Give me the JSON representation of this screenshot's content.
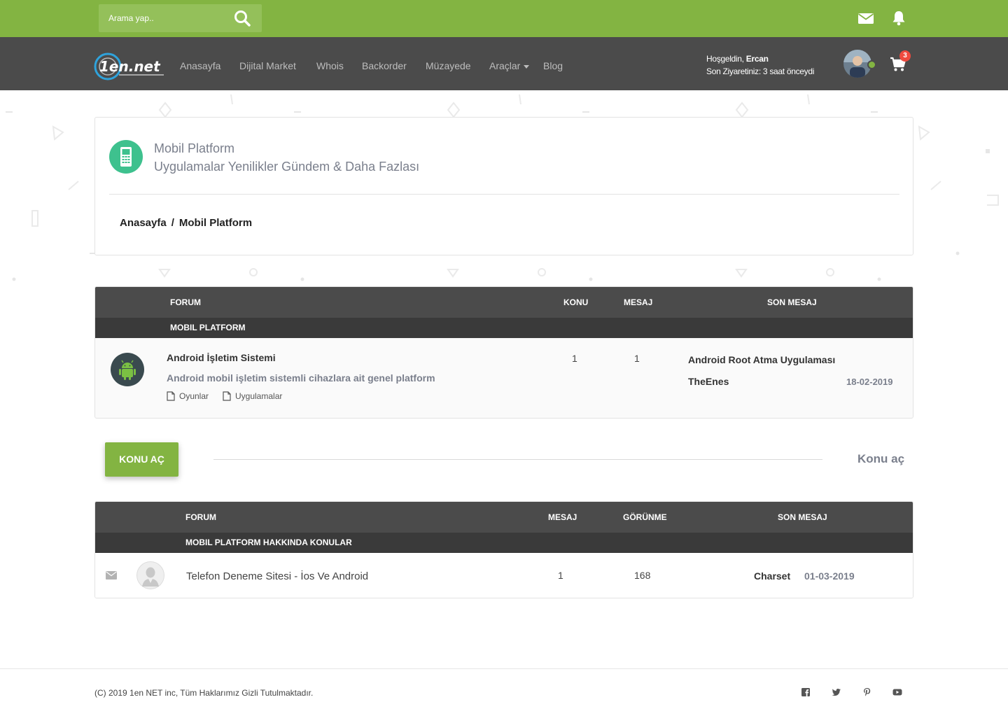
{
  "search": {
    "placeholder": "Arama yap.."
  },
  "header": {
    "mail_icon": "envelope-icon",
    "notification_icon": "bell-icon"
  },
  "nav": {
    "items": [
      "Anasayfa",
      "Dijital Market",
      "Whois",
      "Backorder",
      "Müzayede",
      "Araçlar",
      "Blog"
    ],
    "user": {
      "greeting_prefix": "Hoşgeldin, ",
      "name": "Ercan",
      "last_visit": "Son Ziyaretiniz: 3 saat önceydi"
    },
    "cart_count": "3"
  },
  "page_header": {
    "title": "Mobil Platform",
    "subtitle": "Uygulamalar Yenilikler Gündem & Daha Fazlası",
    "breadcrumb": [
      "Anasayfa",
      "Mobil Platform"
    ],
    "breadcrumb_sep": "/"
  },
  "forum_table": {
    "columns": {
      "forum": "FORUM",
      "konu": "KONU",
      "mesaj": "MESAJ",
      "son_mesaj": "SON MESAJ"
    },
    "group": "MOBIL PLATFORM",
    "rows": [
      {
        "title": "Android İşletim Sistemi",
        "description": "Android mobil işletim sistemli cihazlara ait genel platform",
        "subforums": [
          "Oyunlar",
          "Uygulamalar"
        ],
        "konu": "1",
        "mesaj": "1",
        "last_title": "Android Root Atma Uygulaması",
        "last_user": "TheEnes",
        "last_date": "18-02-2019"
      }
    ]
  },
  "actions": {
    "new_topic_button": "KONU AÇ",
    "new_topic_link": "Konu aç"
  },
  "topics_table": {
    "columns": {
      "forum": "FORUM",
      "mesaj": "MESAJ",
      "gorunme": "GÖRÜNME",
      "son_mesaj": "SON MESAJ"
    },
    "group": "MOBIL PLATFORM HAKKINDA KONULAR",
    "rows": [
      {
        "title": "Telefon Deneme Sitesi - İos Ve Android",
        "mesaj": "1",
        "gorunme": "168",
        "last_user": "Charset",
        "last_date": "01-03-2019"
      }
    ]
  },
  "footer": {
    "copyright": "(C) 2019 1en NET inc, Tüm Haklarımız Gizli Tutulmaktadır.",
    "social": [
      "facebook-icon",
      "twitter-icon",
      "pinterest-icon",
      "youtube-icon"
    ]
  },
  "colors": {
    "brand_green": "#83b442",
    "nav_dark": "#4b4b4b",
    "badge_red": "#ef4a3e",
    "icon_teal": "#3ec18e"
  }
}
